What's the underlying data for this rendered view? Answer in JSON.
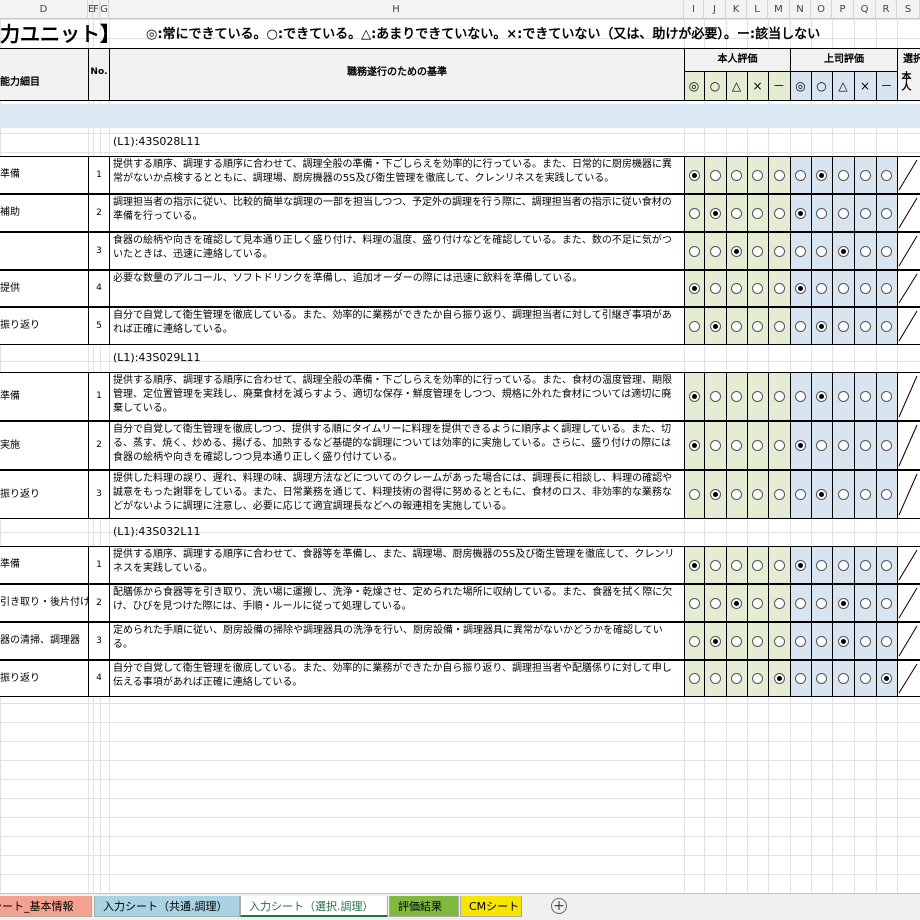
{
  "columns": [
    "D",
    "E",
    "F",
    "G",
    "H",
    "I",
    "J",
    "K",
    "L",
    "M",
    "N",
    "O",
    "P",
    "Q",
    "R",
    "S"
  ],
  "title_left": "力ユニット】",
  "legend": "◎:常にできている。○:できている。△:あまりできていない。×:できていない（又は、助けが必要）。ー:該当しない",
  "header": {
    "detail_label": "能力細目",
    "no_label": "No.",
    "criteria_label": "職務遂行のための基準",
    "self_label": "本人評価",
    "boss_label": "上司評価",
    "select_label": "選択",
    "self_short": "本人",
    "symbols": [
      "◎",
      "○",
      "△",
      "×",
      "－"
    ]
  },
  "units": [
    {
      "code": "(L1):43S028L11",
      "rows": [
        {
          "task": "準備",
          "no": "1",
          "text": "提供する順序、調理する順序に合わせて、調理全般の準備・下ごしらえを効率的に行っている。また、日常的に厨房機器に異常がないか点検するとともに、調理場、厨房機器の5S及び衛生管理を徹底して、クレンリネスを実践している。",
          "self": 0,
          "boss": 1
        },
        {
          "task": "補助",
          "no": "2",
          "text": "調理担当者の指示に従い、比較的簡単な調理の一部を担当しつつ、予定外の調理を行う際に、調理担当者の指示に従い食材の準備を行っている。",
          "self": 1,
          "boss": 0
        },
        {
          "task": "",
          "no": "3",
          "text": "食器の絵柄や向きを確認して見本通り正しく盛り付け、料理の温度、盛り付けなどを確認している。また、数の不足に気がついたときは、迅速に連絡している。",
          "self": 2,
          "boss": 2
        },
        {
          "task": "提供",
          "no": "4",
          "text": "必要な数量のアルコール、ソフトドリンクを準備し、追加オーダーの際には迅速に飲料を準備している。",
          "self": 0,
          "boss": 0
        },
        {
          "task": "振り返り",
          "no": "5",
          "text": "自分で自覚して衛生管理を徹底している。また、効率的に業務ができたか自ら振り返り、調理担当者に対して引継ぎ事項があれば正確に連絡している。",
          "self": 1,
          "boss": 1
        }
      ]
    },
    {
      "code": "(L1):43S029L11",
      "rows": [
        {
          "task": "準備",
          "no": "1",
          "text": "提供する順序、調理する順序に合わせて、調理全般の準備・下ごしらえを効率的に行っている。また、食材の温度管理、期限管理、定位置管理を実践し、廃棄食材を減らすよう、適切な保存・鮮度管理をしつつ、規格に外れた食材については適切に廃棄している。",
          "self": 0,
          "boss": 1
        },
        {
          "task": "実施",
          "no": "2",
          "text": "自分で自覚して衛生管理を徹底しつつ、提供する順にタイムリーに料理を提供できるように順序よく調理している。また、切る、蒸す、焼く、炒める、揚げる、加熱するなど基礎的な調理については効率的に実施している。さらに、盛り付けの際には食器の絵柄や向きを確認しつつ見本通り正しく盛り付けている。",
          "self": 0,
          "boss": 0
        },
        {
          "task": "振り返り",
          "no": "3",
          "text": "提供した料理の誤り、遅れ、料理の味、調理方法などについてのクレームがあった場合には、調理長に相談し、料理の確認や誠意をもった謝罪をしている。また、日常業務を通じて、料理技術の習得に努めるとともに、食材のロス、非効率的な業務などがないように調理に注意し、必要に応じて適宜調理長などへの報連相を実施している。",
          "self": 1,
          "boss": 1
        }
      ]
    },
    {
      "code": "(L1):43S032L11",
      "rows": [
        {
          "task": "準備",
          "no": "1",
          "text": "提供する順序、調理する順序に合わせて、食器等を準備し、また、調理場、厨房機器の5S及び衛生管理を徹底して、クレンリネスを実践している。",
          "self": 0,
          "boss": 0
        },
        {
          "task": "引き取り・後片付け",
          "no": "2",
          "text": "配膳係から食器等を引き取り、洗い場に運搬し、洗浄・乾燥させ、定められた場所に収納している。また、食器を拭く際に欠け、ひびを見つけた際には、手順・ルールに従って処理している。",
          "self": 2,
          "boss": 2
        },
        {
          "task": "器の清掃、調理器",
          "no": "3",
          "text": "定められた手順に従い、厨房設備の掃除や調理器具の洗浄を行い、厨房設備・調理器具に異常がないかどうかを確認している。",
          "self": 1,
          "boss": 2
        },
        {
          "task": "振り返り",
          "no": "4",
          "text": "自分で自覚して衛生管理を徹底している。また、効率的に業務ができたか自ら振り返り、調理担当者や配膳係りに対して申し伝える事項があれば正確に連絡している。",
          "self": 4,
          "boss": 4
        }
      ]
    }
  ],
  "tabs": [
    {
      "label": "シート_基本情報",
      "color": "#f4a18f"
    },
    {
      "label": "入力シート（共通.調理）",
      "color": "#a9d2e3"
    },
    {
      "label": "入力シート（選択.調理）",
      "color": "#ffffff"
    },
    {
      "label": "評価結果",
      "color": "#7fba3f"
    },
    {
      "label": "CMシート",
      "color": "#f5e500"
    }
  ],
  "add_sheet_icon": "plus-circle-icon",
  "colors": {
    "self_bg": "#e4ecd3",
    "boss_bg": "#d8e5f0",
    "band_bg": "#dbeaf4",
    "header_bg": "#f2f2f2"
  }
}
